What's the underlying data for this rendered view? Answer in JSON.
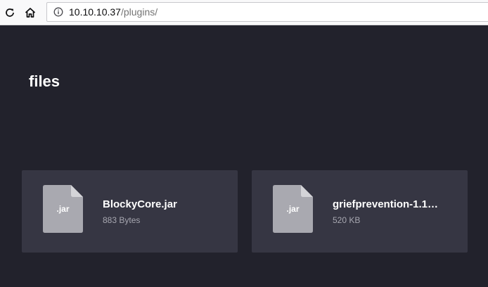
{
  "browser": {
    "url_host": "10.10.10.37",
    "url_path": "/plugins/",
    "reload_icon": "reload-icon",
    "home_icon": "home-icon",
    "info_icon": "info-icon"
  },
  "page": {
    "heading": "files",
    "files": [
      {
        "ext": ".jar",
        "name": "BlockyCore.jar",
        "size": "883 Bytes"
      },
      {
        "ext": ".jar",
        "name": "griefprevention-1.1…",
        "size": "520 KB"
      }
    ]
  },
  "colors": {
    "background": "#22222c",
    "card": "#363643",
    "file_icon": "#a9a9b0"
  }
}
